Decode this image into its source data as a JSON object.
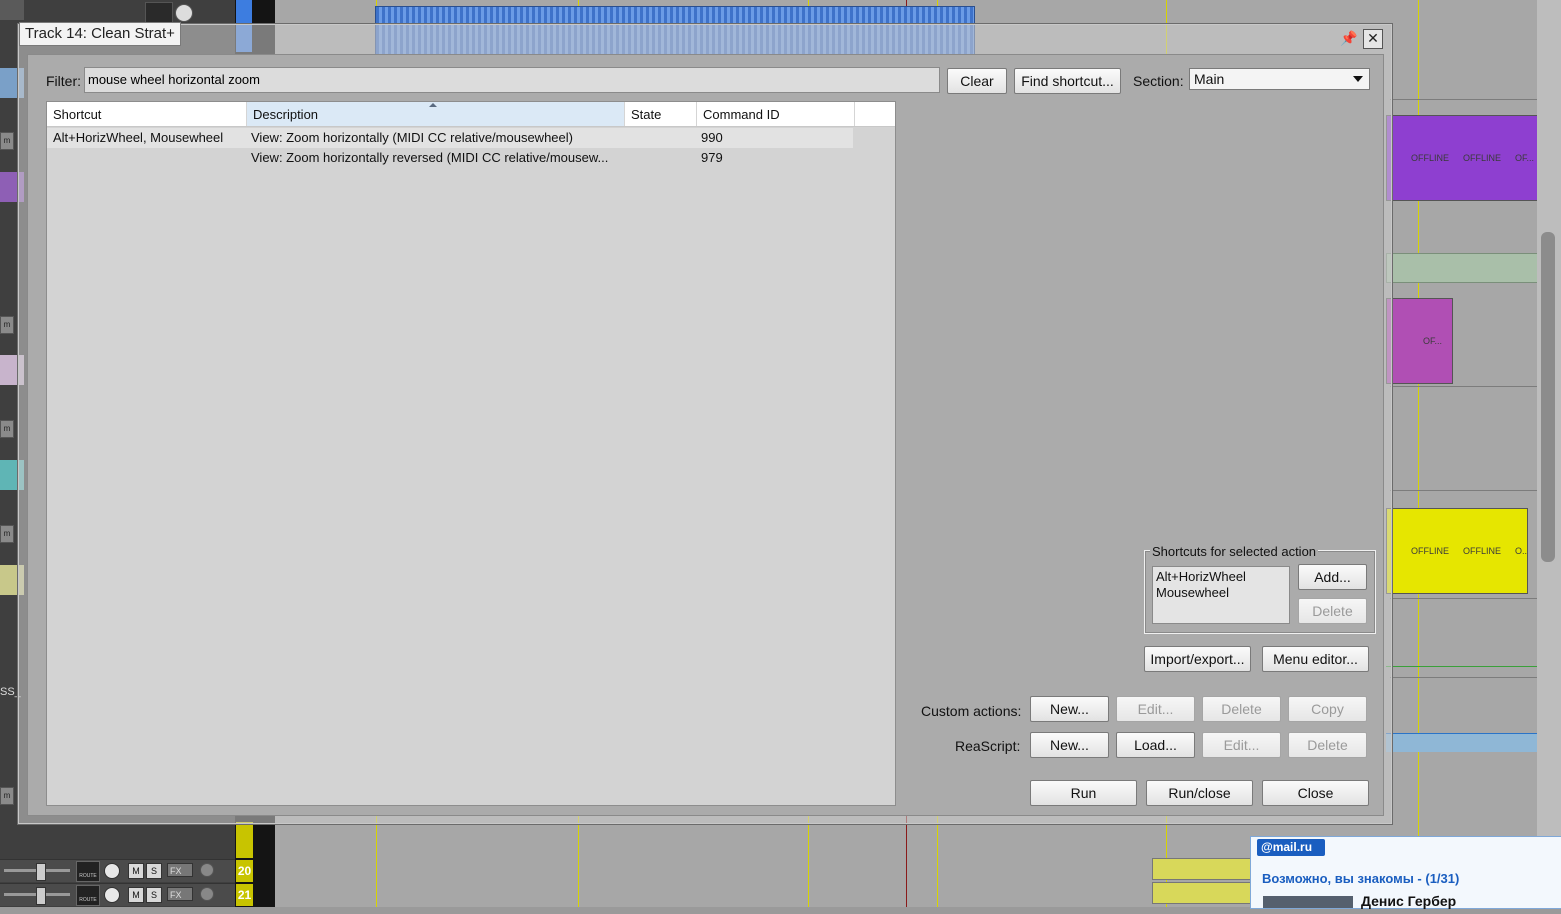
{
  "background": {
    "track_numbers": [
      "20",
      "21"
    ],
    "item_label": "OFFLINE",
    "item_label_short": "OF...",
    "item_label_tiny": "O..",
    "msb": {
      "m": "M",
      "s": "S",
      "fx": "FX"
    },
    "route_label": "ROUTE",
    "side_labels": {
      "m": "m",
      "ss": "SS_"
    }
  },
  "mail_popup": {
    "logo": "@mail.ru",
    "title": "Возможно, вы знакомы - (1/31)",
    "name": "Денис Гербер"
  },
  "dialog": {
    "title": "Track 14: Clean Strat+",
    "filter_label": "Filter:",
    "filter_value": "mouse wheel horizontal zoom",
    "clear_label": "Clear",
    "find_shortcut_label": "Find shortcut...",
    "section_label": "Section:",
    "section_value": "Main",
    "columns": {
      "shortcut": "Shortcut",
      "description": "Description",
      "state": "State",
      "command_id": "Command ID"
    },
    "rows": [
      {
        "shortcut": "Alt+HorizWheel, Mousewheel",
        "description": "View: Zoom horizontally (MIDI CC relative/mousewheel)",
        "state": "",
        "command_id": "990"
      },
      {
        "shortcut": "",
        "description": "View: Zoom horizontally reversed (MIDI CC relative/mousew...",
        "state": "",
        "command_id": "979"
      }
    ],
    "shortcuts_group_label": "Shortcuts for selected action",
    "selected_shortcuts": [
      "Alt+HorizWheel",
      "Mousewheel"
    ],
    "add_label": "Add...",
    "delete_label": "Delete",
    "import_export_label": "Import/export...",
    "menu_editor_label": "Menu editor...",
    "custom_actions_label": "Custom actions:",
    "custom_new_label": "New...",
    "custom_edit_label": "Edit...",
    "custom_delete_label": "Delete",
    "custom_copy_label": "Copy",
    "reascript_label": "ReaScript:",
    "reascript_new_label": "New...",
    "reascript_load_label": "Load...",
    "reascript_edit_label": "Edit...",
    "reascript_delete_label": "Delete",
    "run_label": "Run",
    "run_close_label": "Run/close",
    "close_label": "Close"
  }
}
